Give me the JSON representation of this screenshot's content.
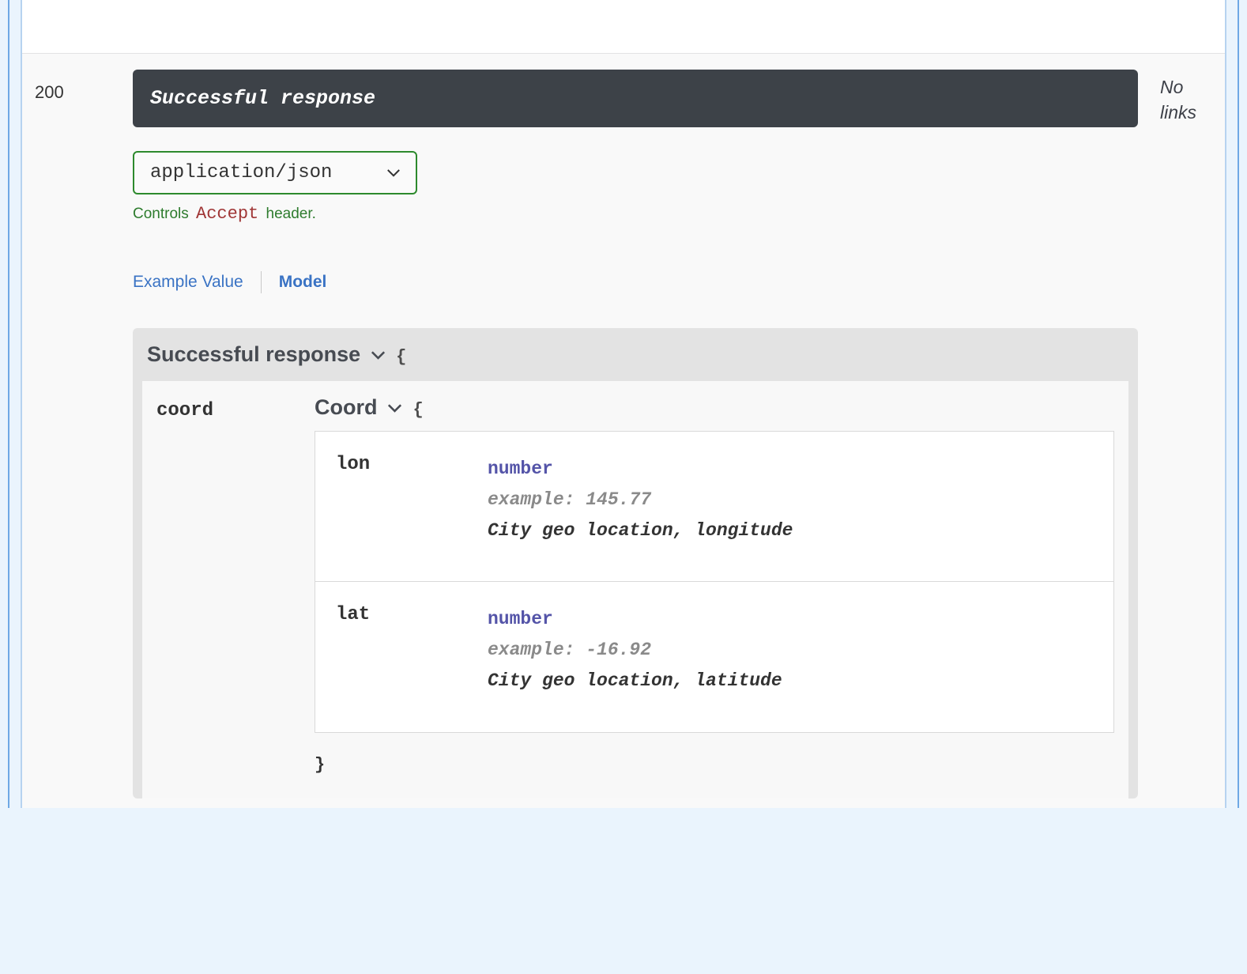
{
  "response": {
    "status_code": "200",
    "description": "Successful response",
    "links_text": "No links"
  },
  "media": {
    "selected": "application/json",
    "hint_controls": "Controls",
    "hint_accept": "Accept",
    "hint_header": "header."
  },
  "tabs": {
    "example": "Example Value",
    "model": "Model"
  },
  "model": {
    "title": "Successful response",
    "brace_open": "{",
    "brace_close": "}",
    "coord": {
      "key": "coord",
      "type_title": "Coord",
      "props": {
        "lon": {
          "name": "lon",
          "type": "number",
          "example": "example: 145.77",
          "desc": "City geo location, longitude"
        },
        "lat": {
          "name": "lat",
          "type": "number",
          "example": "example: -16.92",
          "desc": "City geo location, latitude"
        }
      }
    }
  }
}
